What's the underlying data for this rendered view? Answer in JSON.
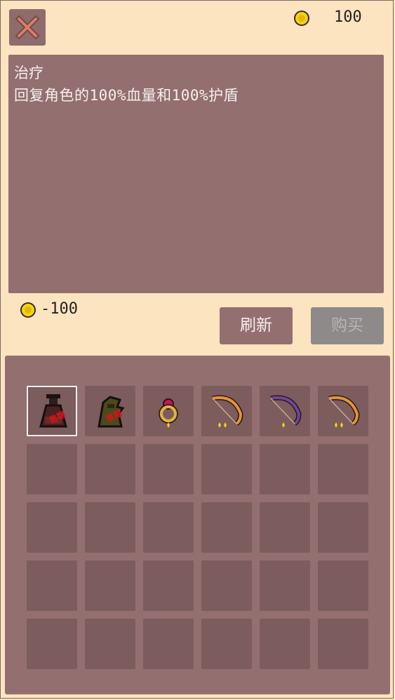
{
  "header": {
    "close_icon": "close-x-icon",
    "gold_icon": "gold-coin-icon",
    "gold_amount": "100"
  },
  "description": {
    "title": "治疗",
    "text": "回复角色的100%血量和100%护盾"
  },
  "price": {
    "coin_icon": "gold-coin-icon",
    "text": "-100"
  },
  "actions": {
    "refresh_label": "刷新",
    "buy_label": "购买",
    "buy_enabled": false
  },
  "inventory": {
    "rows": 5,
    "cols": 6,
    "items": [
      {
        "icon": "potion-flask-icon",
        "selected": true,
        "stamp": "售罄"
      },
      {
        "icon": "dark-cloak-icon",
        "selected": false,
        "stamp": "售罄"
      },
      {
        "icon": "ruby-ring-icon",
        "selected": false
      },
      {
        "icon": "orange-bow-icon",
        "selected": false
      },
      {
        "icon": "purple-bow-icon",
        "selected": false
      },
      {
        "icon": "orange-bow-icon",
        "selected": false
      }
    ]
  },
  "colors": {
    "background": "#fde4c0",
    "panel": "#946f6f",
    "slot": "#7d5c5e",
    "coin": "#f4d21c",
    "stamp": "#d0161b"
  }
}
